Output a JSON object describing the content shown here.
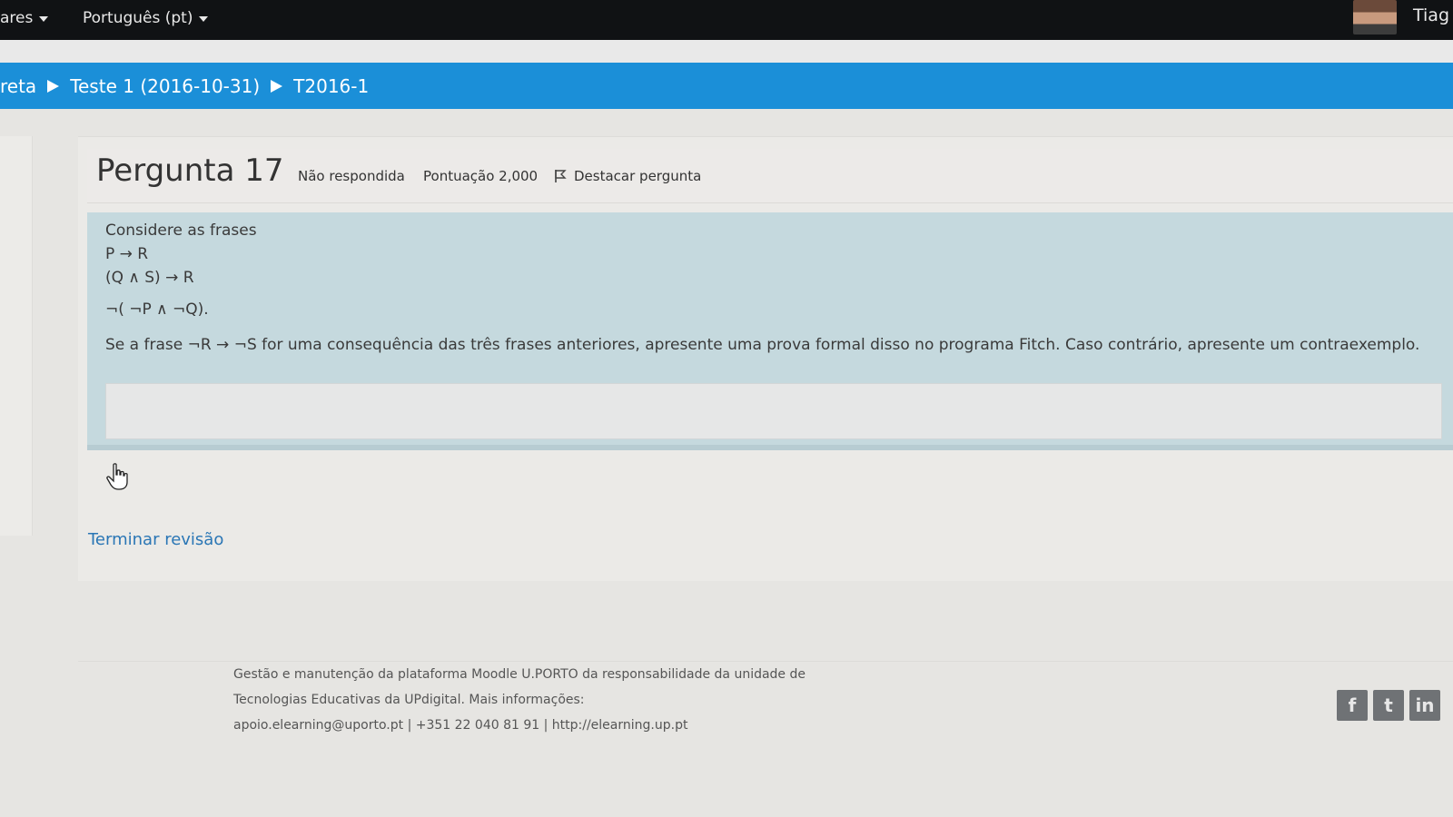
{
  "navbar": {
    "menu1_label": "ares",
    "language_label": "Português (pt)",
    "username": "Tiag"
  },
  "breadcrumb": {
    "items": [
      "reta",
      "Teste 1 (2016-10-31)",
      "T2016-1"
    ]
  },
  "question": {
    "title": "Pergunta 17",
    "state": "Não respondida",
    "grade": "Pontuação 2,000",
    "flag_label": "Destacar pergunta",
    "intro": "Considere as frases",
    "sentences": [
      "P → R",
      "(Q ∧ S) → R",
      "¬( ¬P ∧ ¬Q)."
    ],
    "prompt": "Se a frase ¬R → ¬S for uma consequência das três frases anteriores, apresente uma prova formal disso no programa Fitch. Caso contrário, apresente um contraexemplo.",
    "answer_value": ""
  },
  "actions": {
    "finish_review": "Terminar revisão"
  },
  "footer": {
    "line1": "Gestão e manutenção da plataforma Moodle U.PORTO da responsabilidade da unidade de",
    "line2": "Tecnologias Educativas da UPdigital. Mais informações:",
    "line3": "apoio.elearning@uporto.pt | +351 22 040 81 91 | http://elearning.up.pt",
    "social": [
      "f",
      "t",
      "in"
    ]
  },
  "colors": {
    "navbar_bg": "#101214",
    "breadcrumb_bg": "#1b8fd8",
    "question_body_bg": "#c5d9de",
    "link": "#2a76b5"
  }
}
